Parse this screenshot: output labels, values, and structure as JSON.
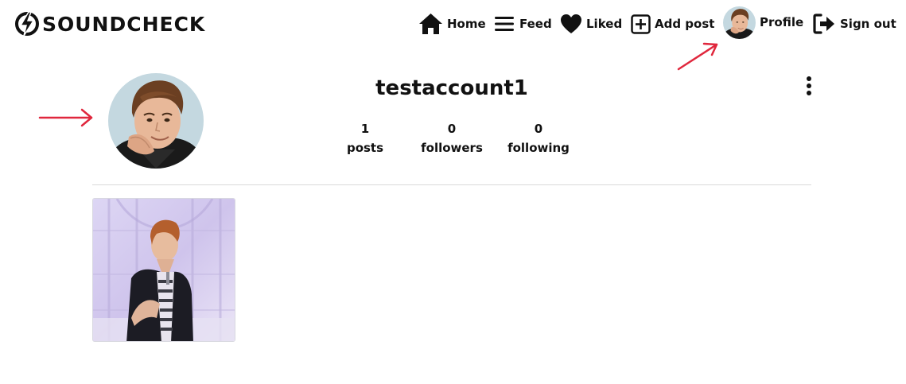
{
  "brand": {
    "name": "SOUNDCHECK",
    "icon": "lightning-bolt-icon"
  },
  "nav": {
    "home": {
      "label": "Home",
      "icon": "home-icon"
    },
    "feed": {
      "label": "Feed",
      "icon": "menu-lines-icon"
    },
    "liked": {
      "label": "Liked",
      "icon": "heart-icon"
    },
    "add_post": {
      "label": "Add post",
      "icon": "plus-square-icon"
    },
    "profile": {
      "label": "Profile",
      "icon": "avatar"
    },
    "sign_out": {
      "label": "Sign out",
      "icon": "sign-out-icon"
    }
  },
  "profile": {
    "username": "testaccount1",
    "stats": [
      {
        "value": "1",
        "label": "posts"
      },
      {
        "value": "0",
        "label": "followers"
      },
      {
        "value": "0",
        "label": "following"
      }
    ],
    "options_icon": "kebab-menu-icon"
  },
  "posts": [
    {
      "icon": "post-image"
    }
  ],
  "colors": {
    "annotation_arrow": "#e0273d",
    "text": "#111111",
    "divider": "#dadada"
  }
}
